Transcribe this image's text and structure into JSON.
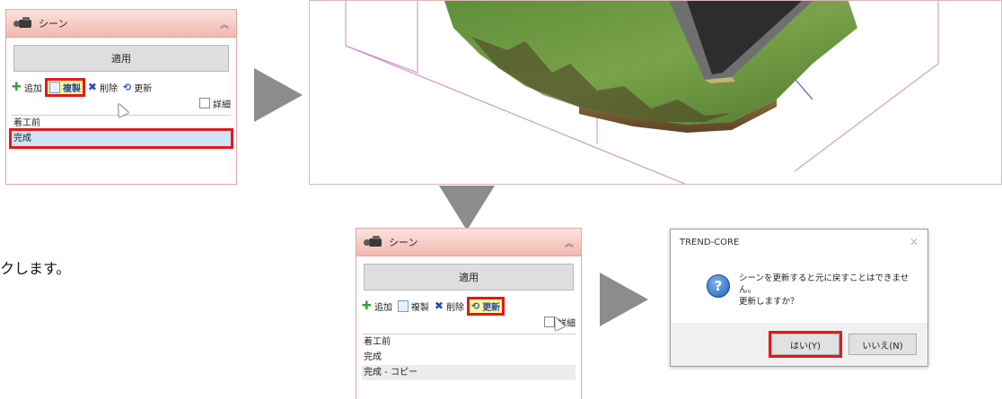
{
  "caption_fragment": "クします。",
  "panel_top": {
    "title": "シーン",
    "collapse_icon": "chevron-up-double",
    "apply_label": "適用",
    "toolbar": {
      "add": "追加",
      "duplicate": "複製",
      "delete": "削除",
      "update": "更新",
      "detail": "詳細"
    },
    "items": [
      "着工前",
      "完成"
    ],
    "selected_item": "完成"
  },
  "panel_bottom": {
    "title": "シーン",
    "apply_label": "適用",
    "toolbar": {
      "add": "追加",
      "duplicate": "複製",
      "delete": "削除",
      "update": "更新",
      "detail": "詳細"
    },
    "items": [
      "着工前",
      "完成",
      "完成 - コピー"
    ],
    "selected_item": "完成 - コピー"
  },
  "dialog": {
    "title": "TREND-CORE",
    "message_line1": "シーンを更新すると元に戻すことはできません。",
    "message_line2": "更新しますか？",
    "yes_label": "はい(Y)",
    "no_label": "いいえ(N)"
  },
  "colors": {
    "highlight_red": "#e01a1a",
    "arrow_gray": "#8c8c8c",
    "panel_header": "#f2b8ae",
    "selection_blue": "#cfe4f5"
  }
}
